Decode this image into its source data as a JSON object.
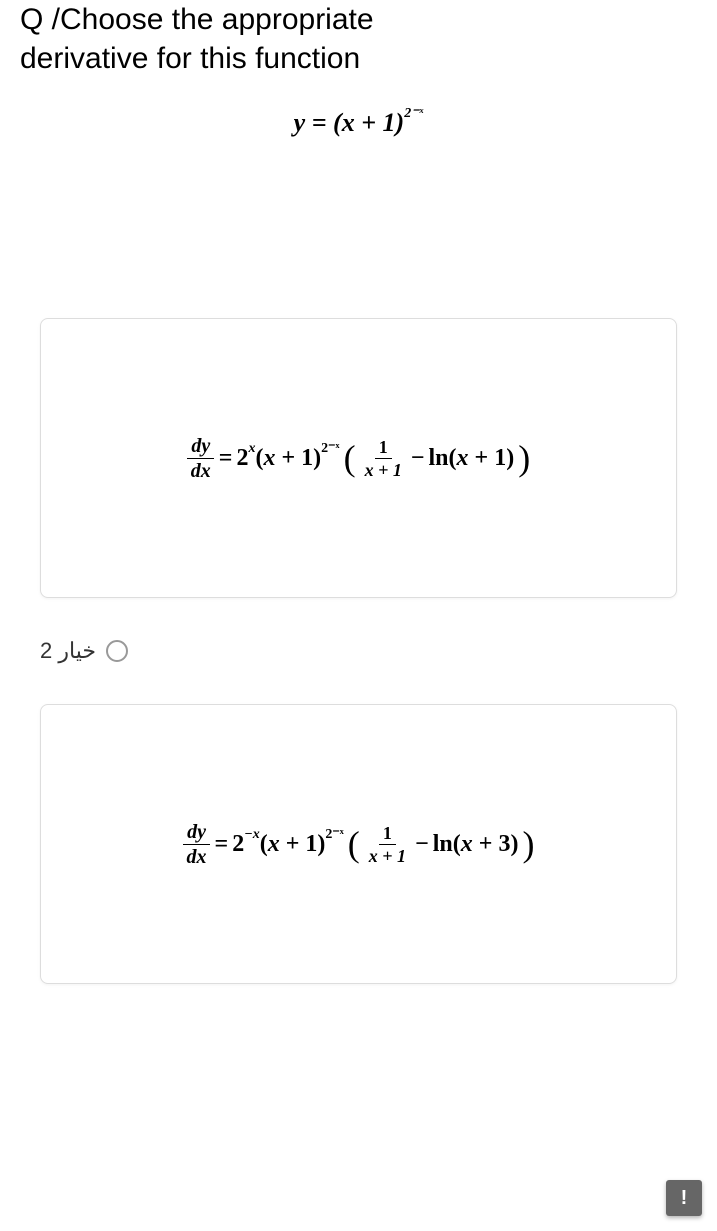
{
  "question": {
    "prefix": "Q /Choose the appropriate",
    "line2": "derivative for this function"
  },
  "function": {
    "lhs": "y",
    "eq": "=",
    "base_open": "(",
    "var": "x",
    "plus": "+ 1)",
    "exp": "2⁻ˣ"
  },
  "options": [
    {
      "dy": "dy",
      "dx": "dx",
      "eq": "=",
      "coef_base": "2",
      "coef_exp": "x",
      "factor_open": "(",
      "factor_var": "x",
      "factor_rest": " + 1)",
      "factor_exp": "2⁻ˣ",
      "paren_open": "(",
      "inner_num": "1",
      "inner_den_var": "x",
      "inner_den_rest": " + 1",
      "minus": "−",
      "ln": "ln(",
      "ln_var": "x",
      "ln_rest": " + 1)",
      "paren_close": ")"
    },
    {
      "dy": "dy",
      "dx": "dx",
      "eq": "=",
      "coef_base": "2",
      "coef_exp": "−x",
      "factor_open": "(",
      "factor_var": "x",
      "factor_rest": " + 1)",
      "factor_exp": "2⁻ˣ",
      "paren_open": "(",
      "inner_num": "1",
      "inner_den_var": "x",
      "inner_den_rest": " + 1",
      "minus": "−",
      "ln": "ln(",
      "ln_var": "x",
      "ln_rest": " + 3)",
      "paren_close": ")"
    }
  ],
  "radio_label": "خيار 2",
  "help_icon": "!"
}
